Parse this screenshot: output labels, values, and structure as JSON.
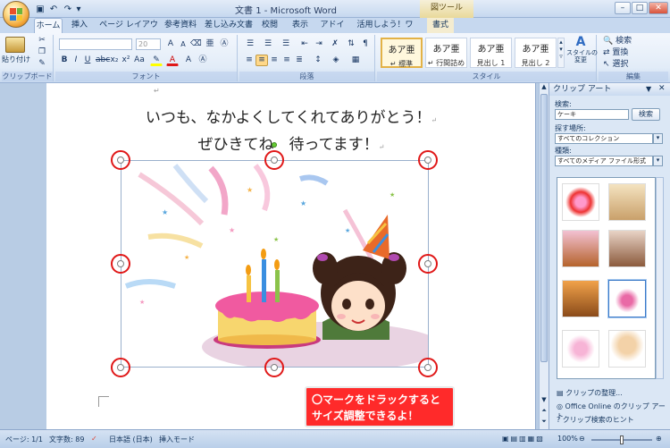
{
  "window": {
    "title": "文書 1 - Microsoft Word",
    "context_tab_group": "図ツール",
    "minimize": "–",
    "maximize": "□",
    "close": "✕"
  },
  "tabs": [
    "ホーム",
    "挿入",
    "ページ レイアウト",
    "参考資料",
    "差し込み文書",
    "校閲",
    "表示",
    "アドイン",
    "活用しよう！ワード",
    "書式"
  ],
  "ribbon": {
    "groups": {
      "clipboard": "クリップボード",
      "font": "フォント",
      "paragraph": "段落",
      "style": "スタイル",
      "edit": "編集"
    },
    "paste_label": "貼り付け",
    "font_name": "",
    "font_size": "20",
    "styles": [
      {
        "preview": "あア亜",
        "name": "↵ 標準"
      },
      {
        "preview": "あア亜",
        "name": "↵ 行間詰め"
      },
      {
        "preview": "あア亜",
        "name": "見出し 1"
      },
      {
        "preview": "あア亜",
        "name": "見出し 2"
      }
    ],
    "change_style": "スタイルの\n変更",
    "edit_items": [
      "検索",
      "置換",
      "選択"
    ]
  },
  "document": {
    "line1": "いつも、なかよくしてくれてありがとう！",
    "line2": "ぜひきてね　待ってます！",
    "para_mark": "↵"
  },
  "callout": {
    "line1": "〇マークをドラックすると",
    "line2": "サイズ調整できるよ！"
  },
  "clip_pane": {
    "title": "クリップ アート",
    "search_label": "検索:",
    "search_value": "ケーキ",
    "search_button": "検索",
    "location_label": "探す場所:",
    "location_value": "すべてのコレクション",
    "type_label": "種類:",
    "type_value": "すべてのメディア ファイル形式",
    "links": [
      "クリップの整理...",
      "Office Online のクリップ アート",
      "クリップ検索のヒント"
    ]
  },
  "status": {
    "page": "ページ: 1/1",
    "words": "文字数: 89",
    "language": "日本語 (日本)",
    "mode": "挿入モード",
    "zoom": "100%"
  },
  "colors": {
    "handle_ring": "#e01818",
    "callout_bg": "#ff2a2a",
    "ribbon_bg": "#e2ecf8"
  }
}
